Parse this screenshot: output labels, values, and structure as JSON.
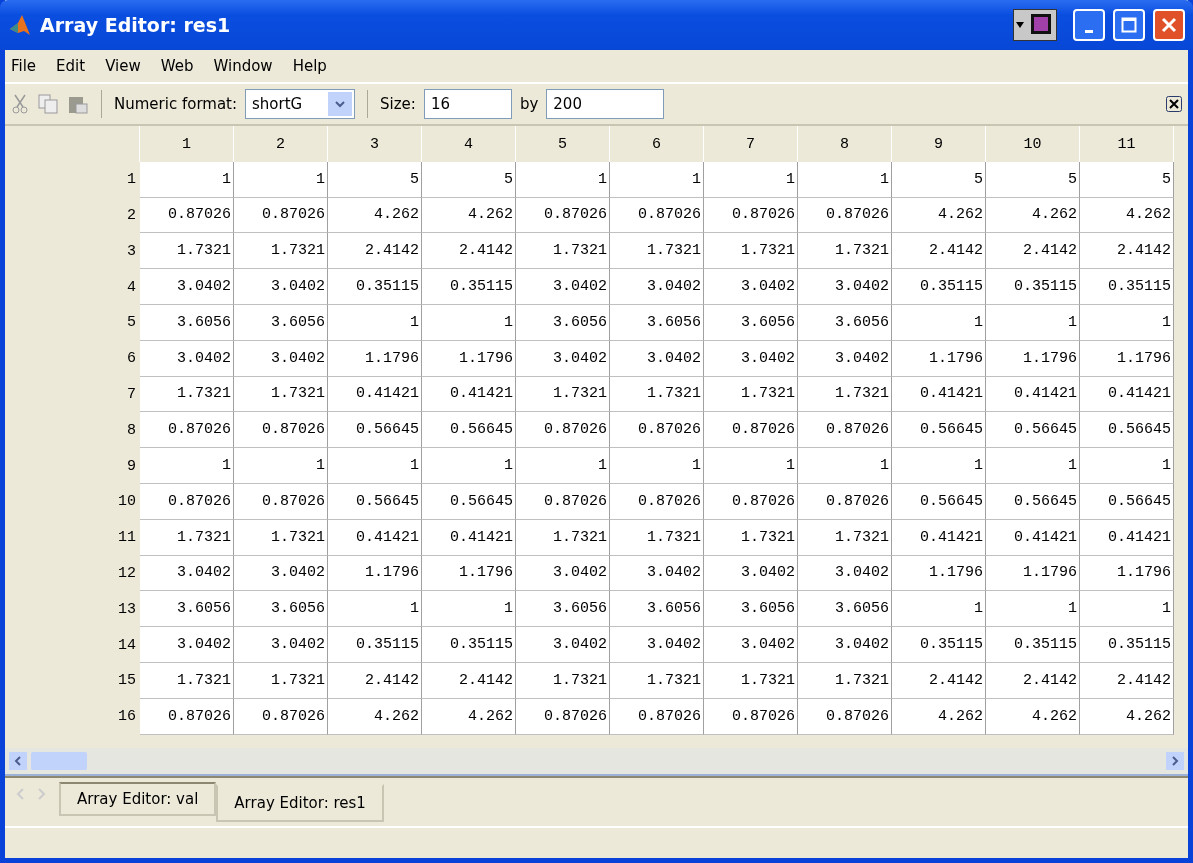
{
  "window": {
    "title": "Array Editor: res1"
  },
  "menu": [
    "File",
    "Edit",
    "View",
    "Web",
    "Window",
    "Help"
  ],
  "toolbar": {
    "format_label": "Numeric format:",
    "format_value": "shortG",
    "size_label": "Size:",
    "rows_value": "16",
    "by_label": "by",
    "cols_value": "200"
  },
  "table": {
    "columns": [
      "1",
      "2",
      "3",
      "4",
      "5",
      "6",
      "7",
      "8",
      "9",
      "10",
      "11"
    ],
    "rows": [
      {
        "label": "1",
        "cells": [
          "1",
          "1",
          "5",
          "5",
          "1",
          "1",
          "1",
          "1",
          "5",
          "5",
          "5"
        ]
      },
      {
        "label": "2",
        "cells": [
          "0.87026",
          "0.87026",
          "4.262",
          "4.262",
          "0.87026",
          "0.87026",
          "0.87026",
          "0.87026",
          "4.262",
          "4.262",
          "4.262"
        ]
      },
      {
        "label": "3",
        "cells": [
          "1.7321",
          "1.7321",
          "2.4142",
          "2.4142",
          "1.7321",
          "1.7321",
          "1.7321",
          "1.7321",
          "2.4142",
          "2.4142",
          "2.4142"
        ]
      },
      {
        "label": "4",
        "cells": [
          "3.0402",
          "3.0402",
          "0.35115",
          "0.35115",
          "3.0402",
          "3.0402",
          "3.0402",
          "3.0402",
          "0.35115",
          "0.35115",
          "0.35115"
        ]
      },
      {
        "label": "5",
        "cells": [
          "3.6056",
          "3.6056",
          "1",
          "1",
          "3.6056",
          "3.6056",
          "3.6056",
          "3.6056",
          "1",
          "1",
          "1"
        ]
      },
      {
        "label": "6",
        "cells": [
          "3.0402",
          "3.0402",
          "1.1796",
          "1.1796",
          "3.0402",
          "3.0402",
          "3.0402",
          "3.0402",
          "1.1796",
          "1.1796",
          "1.1796"
        ]
      },
      {
        "label": "7",
        "cells": [
          "1.7321",
          "1.7321",
          "0.41421",
          "0.41421",
          "1.7321",
          "1.7321",
          "1.7321",
          "1.7321",
          "0.41421",
          "0.41421",
          "0.41421"
        ]
      },
      {
        "label": "8",
        "cells": [
          "0.87026",
          "0.87026",
          "0.56645",
          "0.56645",
          "0.87026",
          "0.87026",
          "0.87026",
          "0.87026",
          "0.56645",
          "0.56645",
          "0.56645"
        ]
      },
      {
        "label": "9",
        "cells": [
          "1",
          "1",
          "1",
          "1",
          "1",
          "1",
          "1",
          "1",
          "1",
          "1",
          "1"
        ]
      },
      {
        "label": "10",
        "cells": [
          "0.87026",
          "0.87026",
          "0.56645",
          "0.56645",
          "0.87026",
          "0.87026",
          "0.87026",
          "0.87026",
          "0.56645",
          "0.56645",
          "0.56645"
        ]
      },
      {
        "label": "11",
        "cells": [
          "1.7321",
          "1.7321",
          "0.41421",
          "0.41421",
          "1.7321",
          "1.7321",
          "1.7321",
          "1.7321",
          "0.41421",
          "0.41421",
          "0.41421"
        ]
      },
      {
        "label": "12",
        "cells": [
          "3.0402",
          "3.0402",
          "1.1796",
          "1.1796",
          "3.0402",
          "3.0402",
          "3.0402",
          "3.0402",
          "1.1796",
          "1.1796",
          "1.1796"
        ]
      },
      {
        "label": "13",
        "cells": [
          "3.6056",
          "3.6056",
          "1",
          "1",
          "3.6056",
          "3.6056",
          "3.6056",
          "3.6056",
          "1",
          "1",
          "1"
        ]
      },
      {
        "label": "14",
        "cells": [
          "3.0402",
          "3.0402",
          "0.35115",
          "0.35115",
          "3.0402",
          "3.0402",
          "3.0402",
          "3.0402",
          "0.35115",
          "0.35115",
          "0.35115"
        ]
      },
      {
        "label": "15",
        "cells": [
          "1.7321",
          "1.7321",
          "2.4142",
          "2.4142",
          "1.7321",
          "1.7321",
          "1.7321",
          "1.7321",
          "2.4142",
          "2.4142",
          "2.4142"
        ]
      },
      {
        "label": "16",
        "cells": [
          "0.87026",
          "0.87026",
          "4.262",
          "4.262",
          "0.87026",
          "0.87026",
          "0.87026",
          "0.87026",
          "4.262",
          "4.262",
          "4.262"
        ]
      }
    ]
  },
  "tabs": [
    {
      "label": "Array Editor: val",
      "selected": false
    },
    {
      "label": "Array Editor: res1",
      "selected": true
    }
  ]
}
